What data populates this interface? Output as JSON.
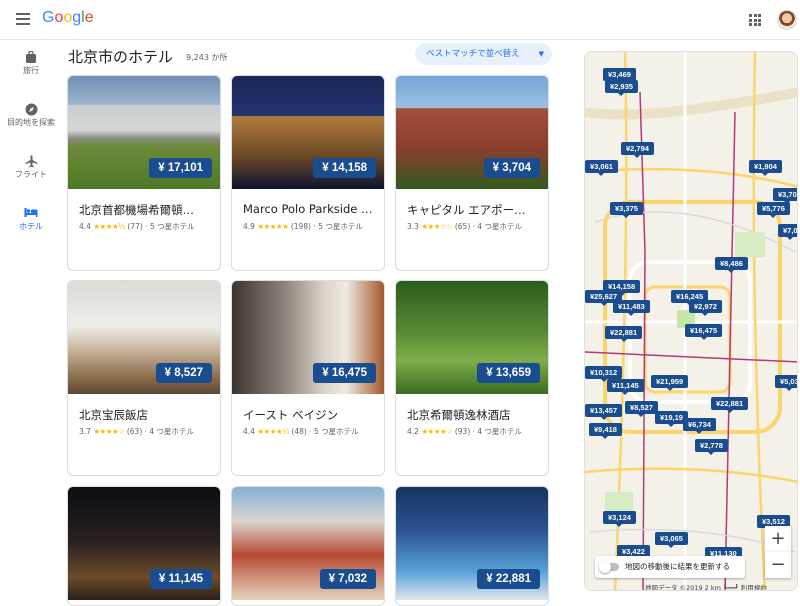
{
  "header": {
    "logo": [
      "G",
      "o",
      "o",
      "g",
      "l",
      "e"
    ]
  },
  "nav": [
    {
      "icon": "suitcase-icon",
      "label": "旅行"
    },
    {
      "icon": "compass-icon",
      "label": "目的地を探索"
    },
    {
      "icon": "plane-icon",
      "label": "フライト"
    },
    {
      "icon": "bed-icon",
      "label": "ホテル"
    }
  ],
  "results": {
    "title": "北京市のホテル",
    "count": "9,243 か所"
  },
  "sort": {
    "label": "ベストマッチで並べ替え"
  },
  "hotels": [
    {
      "price": "¥ 17,101",
      "name": "北京首都機場希爾頓…",
      "rating": "4.4",
      "stars": "★★★★½",
      "reviews": "(77)",
      "class": "5 つ星ホテル"
    },
    {
      "price": "¥ 14,158",
      "name": "Marco Polo Parkside …",
      "rating": "4.9",
      "stars": "★★★★★",
      "reviews": "(198)",
      "class": "5 つ星ホテル"
    },
    {
      "price": "¥ 3,704",
      "name": "キャピタル エアポー…",
      "rating": "3.3",
      "stars": "★★★☆☆",
      "reviews": "(65)",
      "class": "4 つ星ホテル"
    },
    {
      "price": "¥ 8,527",
      "name": "北京宝辰飯店",
      "rating": "3.7",
      "stars": "★★★★☆",
      "reviews": "(63)",
      "class": "4 つ星ホテル"
    },
    {
      "price": "¥ 16,475",
      "name": "イースト ベイジン",
      "rating": "4.4",
      "stars": "★★★★½",
      "reviews": "(48)",
      "class": "5 つ星ホテル"
    },
    {
      "price": "¥ 13,659",
      "name": "北京希爾頓逸林酒店",
      "rating": "4.2",
      "stars": "★★★★☆",
      "reviews": "(93)",
      "class": "4 つ星ホテル"
    },
    {
      "price": "¥ 11,145",
      "name": "",
      "rating": "",
      "stars": "",
      "reviews": "",
      "class": ""
    },
    {
      "price": "¥ 7,032",
      "name": "",
      "rating": "",
      "stars": "",
      "reviews": "",
      "class": ""
    },
    {
      "price": "¥ 22,881",
      "name": "",
      "rating": "",
      "stars": "",
      "reviews": "",
      "class": ""
    }
  ],
  "map": {
    "pins": [
      "¥3,469",
      "¥2,935",
      "¥2,794",
      "¥3,061",
      "¥1,904",
      "¥3,70",
      "¥3,375",
      "¥5,776",
      "¥7,0",
      "¥8,486",
      "¥14,158",
      "¥25,627",
      "¥11,483",
      "¥16,245",
      "¥2,972",
      "¥22,881",
      "¥16,475",
      "¥10,312",
      "¥11,145",
      "¥21,959",
      "¥13,457",
      "¥8,527",
      "¥19,19",
      "¥22,881",
      "¥9,418",
      "¥6,734",
      "¥2,778",
      "¥5,03",
      "¥3,124",
      "¥3,065",
      "¥3,512",
      "¥3,422",
      "¥11,130"
    ],
    "toggle_label": "地図の移動後に結果を更新する",
    "zoom_in": "+",
    "zoom_out": "−",
    "footer": "地図データ ©2019   2 km ┗━━┛   利用規約"
  }
}
